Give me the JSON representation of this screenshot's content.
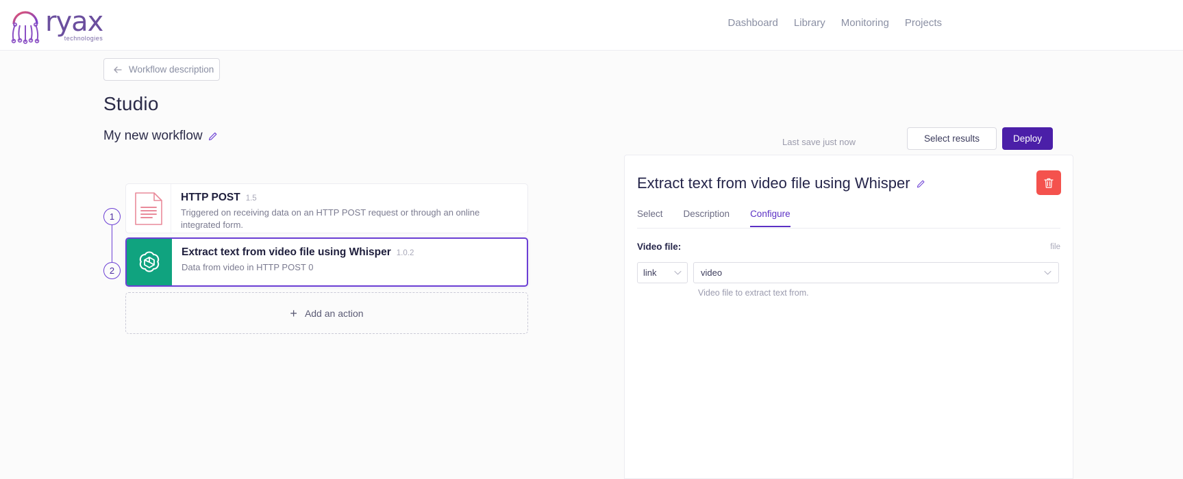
{
  "header": {
    "logo_word": "ryax",
    "logo_sub": "technologies",
    "nav": [
      {
        "label": "Dashboard"
      },
      {
        "label": "Library"
      },
      {
        "label": "Monitoring"
      },
      {
        "label": "Projects"
      }
    ]
  },
  "toolbar": {
    "back_label": "Workflow description",
    "page_title": "Studio",
    "workflow_name": "My new workflow",
    "last_save": "Last save just now",
    "select_results_label": "Select results",
    "deploy_label": "Deploy",
    "accent_color": "#4b1fa8"
  },
  "workflow": {
    "steps": [
      {
        "number": "1",
        "title": "HTTP POST",
        "version": "1.5",
        "description": "Triggered on receiving data on an HTTP POST request or through an online integrated form.",
        "icon": "http-document-icon",
        "icon_color": "#e98a9a"
      },
      {
        "number": "2",
        "title": "Extract text from video file using Whisper",
        "version": "1.0.2",
        "description": "Data from video in HTTP POST 0",
        "icon": "openai-icon",
        "icon_color": "#10a37f"
      }
    ],
    "add_action_label": "Add an action"
  },
  "panel": {
    "title": "Extract text from video file using Whisper",
    "edit_icon": "pencil-icon",
    "delete_icon": "trash-icon",
    "delete_color": "#f4524d",
    "tabs": [
      {
        "label": "Select",
        "active": false
      },
      {
        "label": "Description",
        "active": false
      },
      {
        "label": "Configure",
        "active": true
      }
    ],
    "field": {
      "label": "Video file:",
      "type_hint": "file",
      "source_value": "link",
      "value": "video",
      "help": "Video file to extract text from."
    }
  }
}
